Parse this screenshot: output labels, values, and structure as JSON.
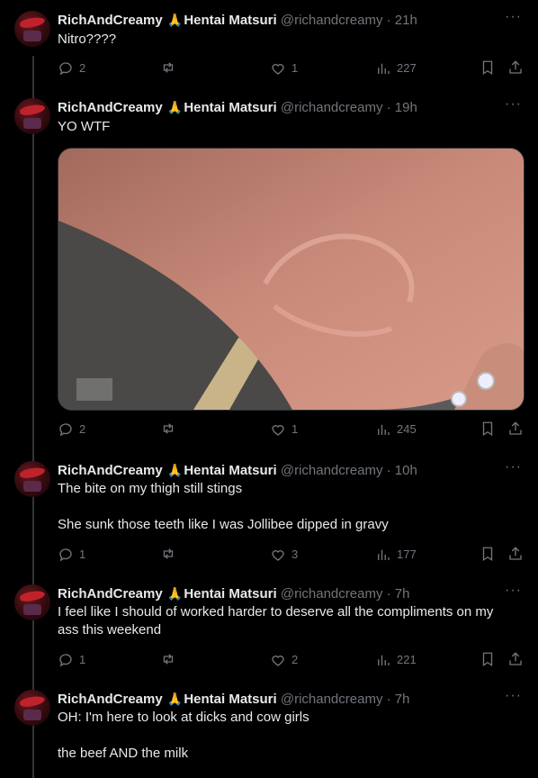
{
  "author": {
    "name": "RichAndCreamy",
    "emoji": "🙏",
    "suffix": "Hentai Matsuri",
    "handle": "@richandcreamy"
  },
  "tweets": [
    {
      "time": "21h",
      "lines": [
        "Nitro????"
      ],
      "replies": "2",
      "retweets": "",
      "likes": "1",
      "views": "227",
      "has_media": false
    },
    {
      "time": "19h",
      "lines": [
        "YO WTF"
      ],
      "replies": "2",
      "retweets": "",
      "likes": "1",
      "views": "245",
      "has_media": true,
      "media_icon": "photo-thigh-bite"
    },
    {
      "time": "10h",
      "lines": [
        "The bite on my thigh still stings",
        "",
        "She sunk those teeth like I was Jollibee dipped in gravy"
      ],
      "replies": "1",
      "retweets": "",
      "likes": "3",
      "views": "177",
      "has_media": false
    },
    {
      "time": "7h",
      "lines": [
        "I feel like I should of worked harder to deserve all the compliments on my ass this weekend"
      ],
      "replies": "1",
      "retweets": "",
      "likes": "2",
      "views": "221",
      "has_media": false
    },
    {
      "time": "7h",
      "lines": [
        "OH: I'm here to look at dicks and cow girls",
        "",
        "the beef AND the milk"
      ],
      "has_media": false
    }
  ],
  "colors": {
    "background": "#000000",
    "text": "#e7e9ea",
    "muted": "#71767b",
    "divider": "#333639"
  },
  "icons": [
    "reply-icon",
    "retweet-icon",
    "like-icon",
    "views-icon",
    "bookmark-icon",
    "share-icon",
    "more-icon"
  ]
}
